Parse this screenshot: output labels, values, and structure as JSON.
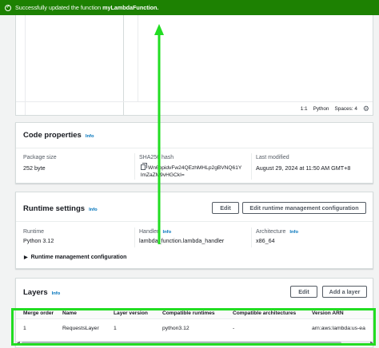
{
  "flash": {
    "prefix": "Successfully updated the function ",
    "function_name": "myLambdaFunction."
  },
  "editor": {
    "cursor_pos": "1:1",
    "language": "Python",
    "spaces": "Spaces: 4"
  },
  "code_properties": {
    "title": "Code properties",
    "info": "Info",
    "package_size_label": "Package size",
    "package_size_value": "252 byte",
    "sha_label": "SHA256 hash",
    "sha_line1": "Wn6ppidvFw24QEzhMHLp2gBVNQ61Y",
    "sha_line2": "lmZaZM9vHGCkI=",
    "last_modified_label": "Last modified",
    "last_modified_value": "August 29, 2024 at 11:50 AM GMT+8"
  },
  "runtime_settings": {
    "title": "Runtime settings",
    "info": "Info",
    "edit_label": "Edit",
    "edit_mgmt_label": "Edit runtime management configuration",
    "runtime_label": "Runtime",
    "runtime_value": "Python 3.12",
    "handler_label": "Handler",
    "handler_info": "Info",
    "handler_value": "lambda_function.lambda_handler",
    "arch_label": "Architecture",
    "arch_info": "Info",
    "arch_value": "x86_64",
    "mgmt_expander": "Runtime management configuration"
  },
  "layers": {
    "title": "Layers",
    "info": "Info",
    "edit_label": "Edit",
    "add_label": "Add a layer",
    "columns": [
      "Merge order",
      "Name",
      "Layer version",
      "Compatible runtimes",
      "Compatible architectures",
      "Version ARN"
    ],
    "rows": [
      [
        "1",
        "RequestsLayer",
        "1",
        "python3.12",
        "-",
        "arn:aws:lambda:us-ea"
      ]
    ]
  },
  "colors": {
    "success": "#1d8102",
    "link": "#0073bb",
    "annotation": "#22dd22"
  }
}
